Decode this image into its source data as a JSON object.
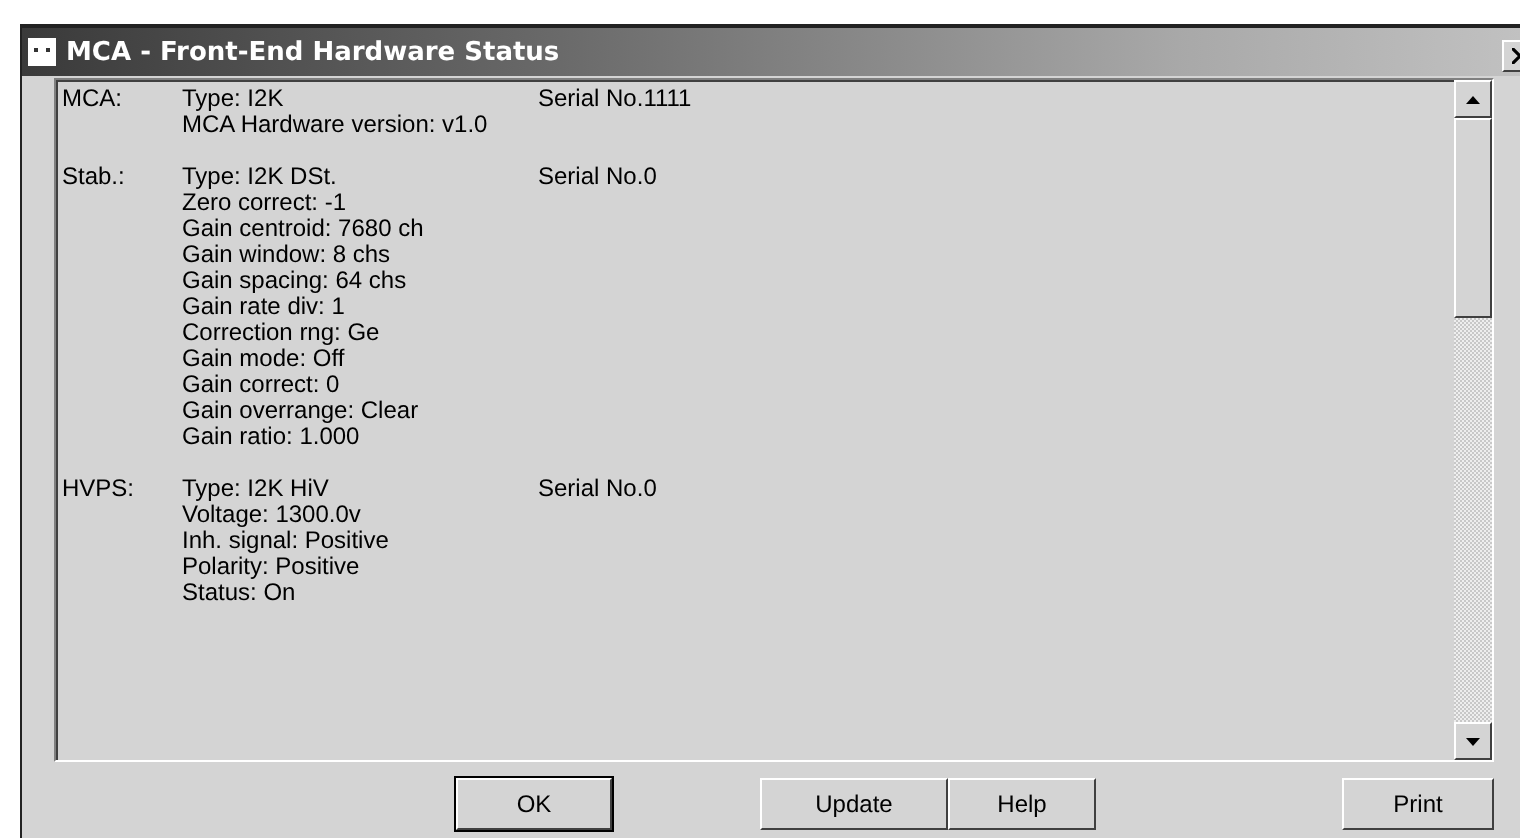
{
  "window": {
    "title": "MCA - Front-End Hardware Status"
  },
  "sections": [
    {
      "label": "MCA:",
      "type": "Type: I2K",
      "serial": "Serial No.1111",
      "lines": [
        "MCA Hardware version: v1.0"
      ]
    },
    {
      "label": "Stab.:",
      "type": "Type: I2K DSt.",
      "serial": "Serial No.0",
      "lines": [
        "Zero correct: -1",
        "Gain centroid: 7680 ch",
        "Gain window: 8 chs",
        "Gain spacing: 64 chs",
        "Gain rate div: 1",
        "Correction rng: Ge",
        "Gain mode: Off",
        "Gain correct: 0",
        "Gain overrange: Clear",
        "Gain ratio: 1.000"
      ]
    },
    {
      "label": "HVPS:",
      "type": "Type: I2K HiV",
      "serial": "Serial No.0",
      "lines": [
        "Voltage: 1300.0v",
        "Inh. signal: Positive",
        "Polarity: Positive",
        "Status: On"
      ]
    }
  ],
  "buttons": [
    {
      "label": "OK",
      "default": true
    },
    {
      "label": "Update",
      "default": false
    },
    {
      "label": "Help",
      "default": false
    },
    {
      "label": "Print",
      "default": false
    }
  ]
}
